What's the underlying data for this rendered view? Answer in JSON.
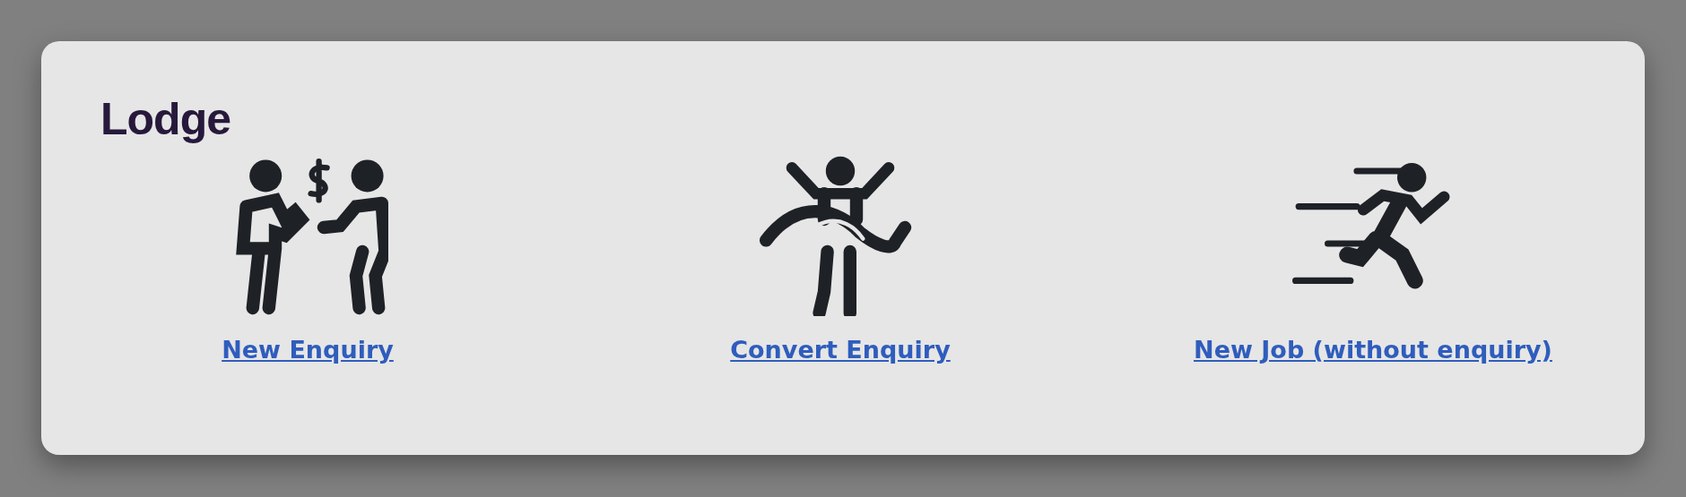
{
  "card": {
    "title": "Lodge",
    "actions": [
      {
        "label": "New Enquiry"
      },
      {
        "label": "Convert Enquiry"
      },
      {
        "label": "New Job (without enquiry)"
      }
    ]
  }
}
